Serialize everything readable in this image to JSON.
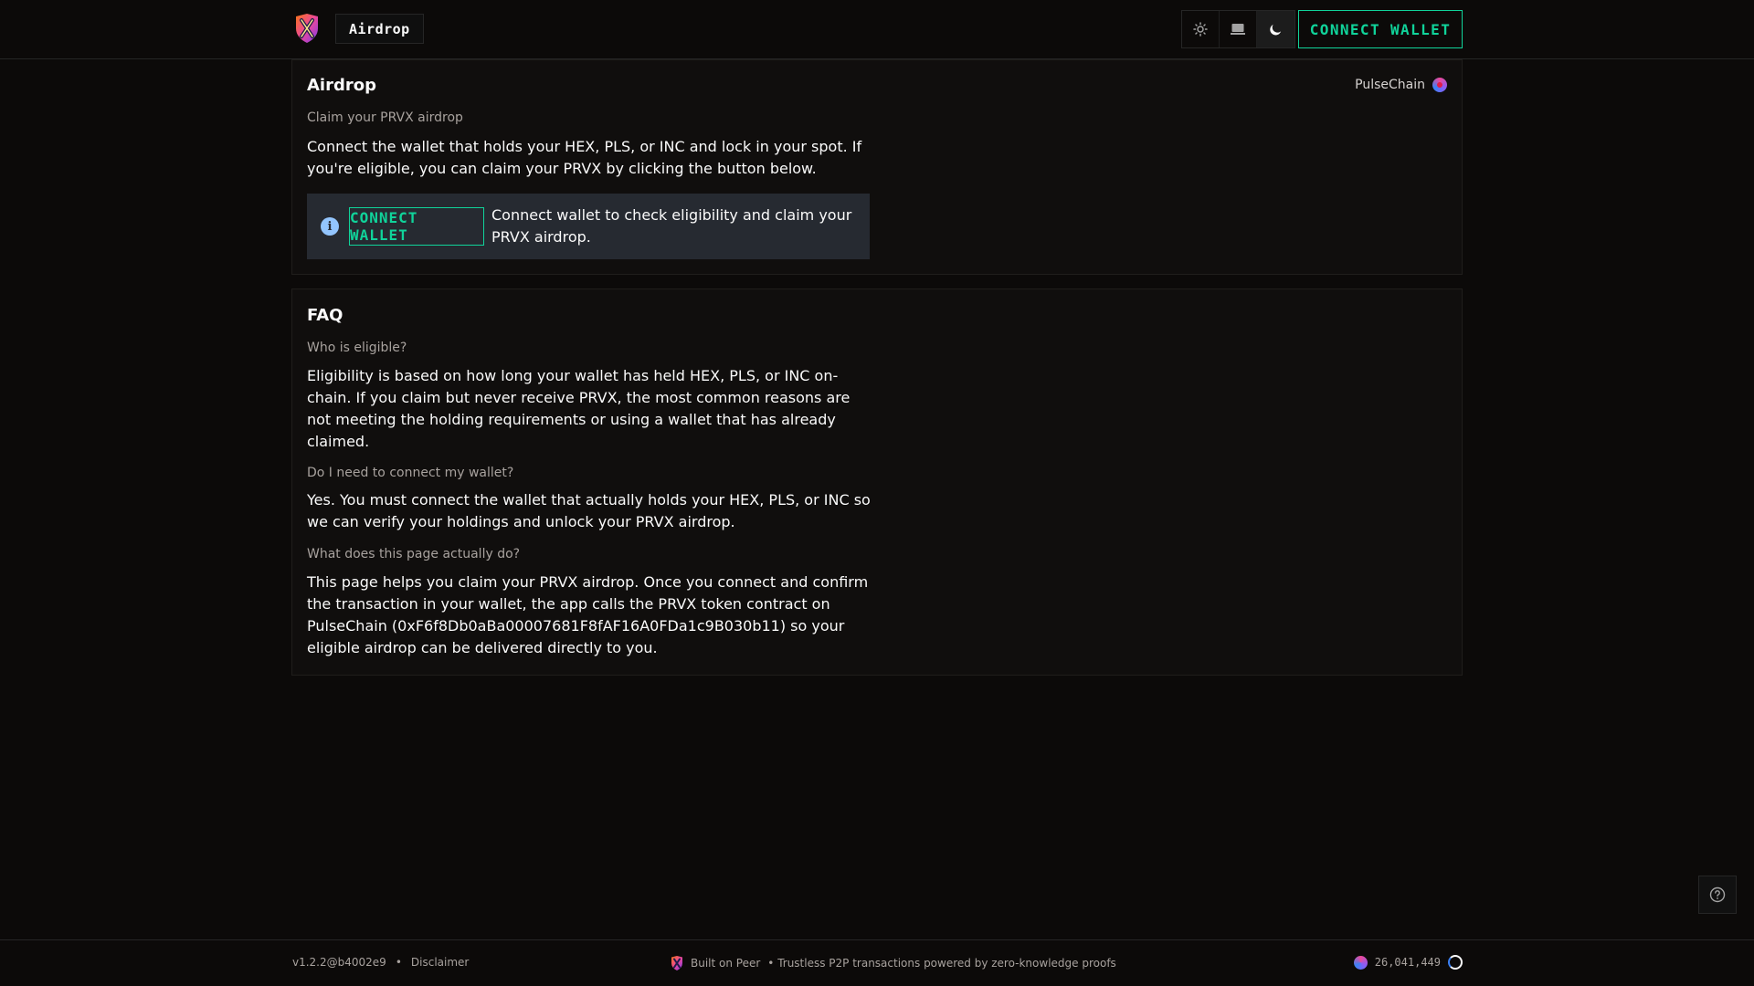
{
  "header": {
    "nav_tab": "Airdrop",
    "connect_label": "CONNECT WALLET",
    "theme_options": [
      "sun-icon",
      "laptop-icon",
      "moon-icon"
    ]
  },
  "airdrop": {
    "title": "Airdrop",
    "network": "PulseChain",
    "subtitle": "Claim your PRVX airdrop",
    "description": "Connect the wallet that holds your HEX, PLS, or INC and lock in your spot. If you're eligible, you can claim your PRVX by clicking the button below.",
    "alert": {
      "button_label": "CONNECT WALLET",
      "message": "Connect wallet to check eligibility and claim your PRVX airdrop."
    }
  },
  "faq": {
    "title": "FAQ",
    "items": [
      {
        "question": "Who is eligible?",
        "answer": "Eligibility is based on how long your wallet has held HEX, PLS, or INC on-chain. If you claim but never receive PRVX, the most common reasons are not meeting the holding requirements or using a wallet that has already claimed."
      },
      {
        "question": "Do I need to connect my wallet?",
        "answer": "Yes. You must connect the wallet that actually holds your HEX, PLS, or INC so we can verify your holdings and unlock your PRVX airdrop."
      },
      {
        "question": "What does this page actually do?",
        "answer": "This page helps you claim your PRVX airdrop. Once you connect and confirm the transaction in your wallet, the app calls the PRVX token contract on PulseChain (0xF6f8Db0aBa00007681F8fAF16A0FDa1c9B030b11) so your eligible airdrop can be delivered directly to you."
      }
    ]
  },
  "footer": {
    "version": "v1.2.2@b4002e9",
    "separator": "•",
    "disclaimer": "Disclaimer",
    "built_on": "Built on Peer",
    "tagline": "• Trustless P2P transactions powered by zero-knowledge proofs",
    "block_number": "26,041,449"
  },
  "colors": {
    "accent": "#10d39a",
    "background": "#0c0a09",
    "alert_bg": "#262a31",
    "info": "#93c5fd"
  }
}
